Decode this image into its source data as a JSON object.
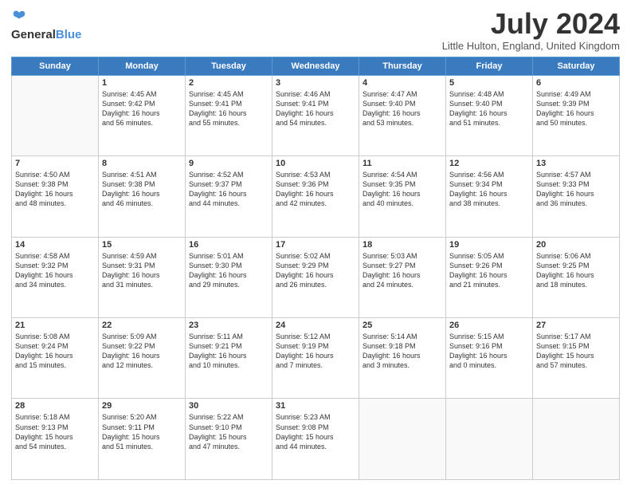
{
  "header": {
    "logo_general": "General",
    "logo_blue": "Blue",
    "title": "July 2024",
    "location": "Little Hulton, England, United Kingdom"
  },
  "weekdays": [
    "Sunday",
    "Monday",
    "Tuesday",
    "Wednesday",
    "Thursday",
    "Friday",
    "Saturday"
  ],
  "weeks": [
    [
      {
        "day": "",
        "text": ""
      },
      {
        "day": "1",
        "text": "Sunrise: 4:45 AM\nSunset: 9:42 PM\nDaylight: 16 hours\nand 56 minutes."
      },
      {
        "day": "2",
        "text": "Sunrise: 4:45 AM\nSunset: 9:41 PM\nDaylight: 16 hours\nand 55 minutes."
      },
      {
        "day": "3",
        "text": "Sunrise: 4:46 AM\nSunset: 9:41 PM\nDaylight: 16 hours\nand 54 minutes."
      },
      {
        "day": "4",
        "text": "Sunrise: 4:47 AM\nSunset: 9:40 PM\nDaylight: 16 hours\nand 53 minutes."
      },
      {
        "day": "5",
        "text": "Sunrise: 4:48 AM\nSunset: 9:40 PM\nDaylight: 16 hours\nand 51 minutes."
      },
      {
        "day": "6",
        "text": "Sunrise: 4:49 AM\nSunset: 9:39 PM\nDaylight: 16 hours\nand 50 minutes."
      }
    ],
    [
      {
        "day": "7",
        "text": "Sunrise: 4:50 AM\nSunset: 9:38 PM\nDaylight: 16 hours\nand 48 minutes."
      },
      {
        "day": "8",
        "text": "Sunrise: 4:51 AM\nSunset: 9:38 PM\nDaylight: 16 hours\nand 46 minutes."
      },
      {
        "day": "9",
        "text": "Sunrise: 4:52 AM\nSunset: 9:37 PM\nDaylight: 16 hours\nand 44 minutes."
      },
      {
        "day": "10",
        "text": "Sunrise: 4:53 AM\nSunset: 9:36 PM\nDaylight: 16 hours\nand 42 minutes."
      },
      {
        "day": "11",
        "text": "Sunrise: 4:54 AM\nSunset: 9:35 PM\nDaylight: 16 hours\nand 40 minutes."
      },
      {
        "day": "12",
        "text": "Sunrise: 4:56 AM\nSunset: 9:34 PM\nDaylight: 16 hours\nand 38 minutes."
      },
      {
        "day": "13",
        "text": "Sunrise: 4:57 AM\nSunset: 9:33 PM\nDaylight: 16 hours\nand 36 minutes."
      }
    ],
    [
      {
        "day": "14",
        "text": "Sunrise: 4:58 AM\nSunset: 9:32 PM\nDaylight: 16 hours\nand 34 minutes."
      },
      {
        "day": "15",
        "text": "Sunrise: 4:59 AM\nSunset: 9:31 PM\nDaylight: 16 hours\nand 31 minutes."
      },
      {
        "day": "16",
        "text": "Sunrise: 5:01 AM\nSunset: 9:30 PM\nDaylight: 16 hours\nand 29 minutes."
      },
      {
        "day": "17",
        "text": "Sunrise: 5:02 AM\nSunset: 9:29 PM\nDaylight: 16 hours\nand 26 minutes."
      },
      {
        "day": "18",
        "text": "Sunrise: 5:03 AM\nSunset: 9:27 PM\nDaylight: 16 hours\nand 24 minutes."
      },
      {
        "day": "19",
        "text": "Sunrise: 5:05 AM\nSunset: 9:26 PM\nDaylight: 16 hours\nand 21 minutes."
      },
      {
        "day": "20",
        "text": "Sunrise: 5:06 AM\nSunset: 9:25 PM\nDaylight: 16 hours\nand 18 minutes."
      }
    ],
    [
      {
        "day": "21",
        "text": "Sunrise: 5:08 AM\nSunset: 9:24 PM\nDaylight: 16 hours\nand 15 minutes."
      },
      {
        "day": "22",
        "text": "Sunrise: 5:09 AM\nSunset: 9:22 PM\nDaylight: 16 hours\nand 12 minutes."
      },
      {
        "day": "23",
        "text": "Sunrise: 5:11 AM\nSunset: 9:21 PM\nDaylight: 16 hours\nand 10 minutes."
      },
      {
        "day": "24",
        "text": "Sunrise: 5:12 AM\nSunset: 9:19 PM\nDaylight: 16 hours\nand 7 minutes."
      },
      {
        "day": "25",
        "text": "Sunrise: 5:14 AM\nSunset: 9:18 PM\nDaylight: 16 hours\nand 3 minutes."
      },
      {
        "day": "26",
        "text": "Sunrise: 5:15 AM\nSunset: 9:16 PM\nDaylight: 16 hours\nand 0 minutes."
      },
      {
        "day": "27",
        "text": "Sunrise: 5:17 AM\nSunset: 9:15 PM\nDaylight: 15 hours\nand 57 minutes."
      }
    ],
    [
      {
        "day": "28",
        "text": "Sunrise: 5:18 AM\nSunset: 9:13 PM\nDaylight: 15 hours\nand 54 minutes."
      },
      {
        "day": "29",
        "text": "Sunrise: 5:20 AM\nSunset: 9:11 PM\nDaylight: 15 hours\nand 51 minutes."
      },
      {
        "day": "30",
        "text": "Sunrise: 5:22 AM\nSunset: 9:10 PM\nDaylight: 15 hours\nand 47 minutes."
      },
      {
        "day": "31",
        "text": "Sunrise: 5:23 AM\nSunset: 9:08 PM\nDaylight: 15 hours\nand 44 minutes."
      },
      {
        "day": "",
        "text": ""
      },
      {
        "day": "",
        "text": ""
      },
      {
        "day": "",
        "text": ""
      }
    ]
  ]
}
